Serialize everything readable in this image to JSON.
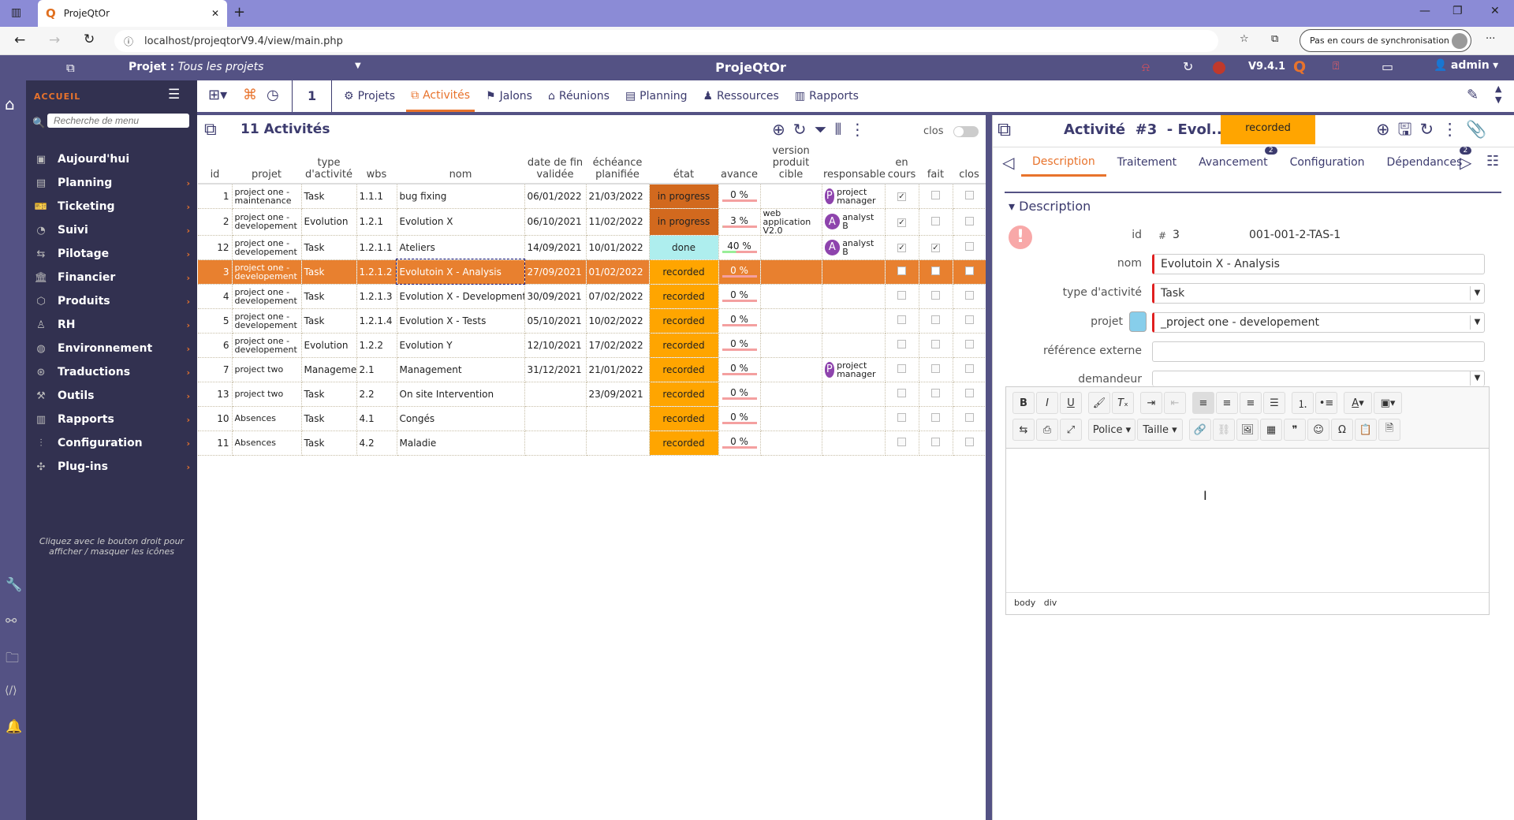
{
  "browser": {
    "tab_title": "ProjeQtOr",
    "url": "localhost/projeqtorV9.4/view/main.php",
    "sync_label": "Pas en cours de synchronisation"
  },
  "header": {
    "project_label": "Projet :",
    "project_value": "Tous les projets",
    "app_title": "ProjeQtOr",
    "version": "V9.4.1",
    "user": "admin"
  },
  "sidebar": {
    "title": "ACCUEIL",
    "search_placeholder": "Recherche de menu",
    "footer": "Cliquez avec le bouton droit pour afficher / masquer les icônes",
    "items": [
      {
        "label": "Aujourd'hui",
        "icon": "calendar-icon",
        "sub": false
      },
      {
        "label": "Planning",
        "icon": "planning-icon",
        "sub": true
      },
      {
        "label": "Ticketing",
        "icon": "ticket-icon",
        "sub": true
      },
      {
        "label": "Suivi",
        "icon": "follow-icon",
        "sub": true
      },
      {
        "label": "Pilotage",
        "icon": "signpost-icon",
        "sub": true
      },
      {
        "label": "Financier",
        "icon": "bank-icon",
        "sub": true
      },
      {
        "label": "Produits",
        "icon": "box-icon",
        "sub": true
      },
      {
        "label": "RH",
        "icon": "person-icon",
        "sub": true
      },
      {
        "label": "Environnement",
        "icon": "globe-icon",
        "sub": true
      },
      {
        "label": "Traductions",
        "icon": "translate-icon",
        "sub": true
      },
      {
        "label": "Outils",
        "icon": "hammer-icon",
        "sub": true
      },
      {
        "label": "Rapports",
        "icon": "chart-icon",
        "sub": true
      },
      {
        "label": "Configuration",
        "icon": "sliders-icon",
        "sub": true
      },
      {
        "label": "Plug-ins",
        "icon": "puzzle-icon",
        "sub": true
      }
    ]
  },
  "toolbar": {
    "count": "1",
    "tabs": [
      {
        "label": "Projets",
        "icon": "gear-icon"
      },
      {
        "label": "Activités",
        "icon": "activity-icon",
        "active": true
      },
      {
        "label": "Jalons",
        "icon": "flag-icon"
      },
      {
        "label": "Réunions",
        "icon": "meeting-icon"
      },
      {
        "label": "Planning",
        "icon": "planning-icon"
      },
      {
        "label": "Ressources",
        "icon": "resource-icon"
      },
      {
        "label": "Rapports",
        "icon": "chart-icon"
      }
    ]
  },
  "list": {
    "title": "11 Activités",
    "closed_label": "clos",
    "columns": [
      "id",
      "projet",
      "type d'activité",
      "wbs",
      "nom",
      "date de fin validée",
      "échéance planifiée",
      "état",
      "avance",
      "version produit cible",
      "responsable",
      "en cours",
      "fait",
      "clos"
    ],
    "rows": [
      {
        "id": "1",
        "projet": "project one - maintenance",
        "type": "Task",
        "wbs": "1.1.1",
        "nom": "bug fixing",
        "fin": "06/01/2022",
        "ech": "21/03/2022",
        "etat": "in progress",
        "avance": "0 %",
        "version": "",
        "resp": "project manager",
        "resp_initial": "P",
        "en_cours": true,
        "fait": false,
        "clos": false
      },
      {
        "id": "2",
        "projet": "project one - developement",
        "type": "Evolution",
        "wbs": "1.2.1",
        "nom": "Evolution X",
        "fin": "06/10/2021",
        "ech": "11/02/2022",
        "etat": "in progress",
        "avance": "3 %",
        "version": "web application V2.0",
        "resp": "analyst B",
        "resp_initial": "A",
        "en_cours": true,
        "fait": false,
        "clos": false
      },
      {
        "id": "12",
        "projet": "project one - developement",
        "type": "Task",
        "wbs": "1.2.1.1",
        "nom": "Ateliers",
        "fin": "14/09/2021",
        "ech": "10/01/2022",
        "etat": "done",
        "avance": "40 %",
        "version": "",
        "resp": "analyst B",
        "resp_initial": "A",
        "en_cours": true,
        "fait": true,
        "clos": false
      },
      {
        "id": "3",
        "projet": "project one - developement",
        "type": "Task",
        "wbs": "1.2.1.2",
        "nom": "Evolutoin X - Analysis",
        "fin": "27/09/2021",
        "ech": "01/02/2022",
        "etat": "recorded",
        "avance": "0 %",
        "version": "",
        "resp": "",
        "resp_initial": "",
        "en_cours": false,
        "fait": false,
        "clos": false,
        "selected": true
      },
      {
        "id": "4",
        "projet": "project one - developement",
        "type": "Task",
        "wbs": "1.2.1.3",
        "nom": "Evolution X - Development",
        "fin": "30/09/2021",
        "ech": "07/02/2022",
        "etat": "recorded",
        "avance": "0 %",
        "version": "",
        "resp": "",
        "resp_initial": "",
        "en_cours": false,
        "fait": false,
        "clos": false
      },
      {
        "id": "5",
        "projet": "project one - developement",
        "type": "Task",
        "wbs": "1.2.1.4",
        "nom": "Evolution X - Tests",
        "fin": "05/10/2021",
        "ech": "10/02/2022",
        "etat": "recorded",
        "avance": "0 %",
        "version": "",
        "resp": "",
        "resp_initial": "",
        "en_cours": false,
        "fait": false,
        "clos": false
      },
      {
        "id": "6",
        "projet": "project one - developement",
        "type": "Evolution",
        "wbs": "1.2.2",
        "nom": "Evolution Y",
        "fin": "12/10/2021",
        "ech": "17/02/2022",
        "etat": "recorded",
        "avance": "0 %",
        "version": "",
        "resp": "",
        "resp_initial": "",
        "en_cours": false,
        "fait": false,
        "clos": false
      },
      {
        "id": "7",
        "projet": "project two",
        "type": "Management",
        "wbs": "2.1",
        "nom": "Management",
        "fin": "31/12/2021",
        "ech": "21/01/2022",
        "etat": "recorded",
        "avance": "0 %",
        "version": "",
        "resp": "project manager",
        "resp_initial": "P",
        "en_cours": false,
        "fait": false,
        "clos": false
      },
      {
        "id": "13",
        "projet": "project two",
        "type": "Task",
        "wbs": "2.2",
        "nom": "On site Intervention",
        "fin": "",
        "ech": "23/09/2021",
        "etat": "recorded",
        "avance": "0 %",
        "version": "",
        "resp": "",
        "resp_initial": "",
        "en_cours": false,
        "fait": false,
        "clos": false
      },
      {
        "id": "10",
        "projet": "Absences",
        "type": "Task",
        "wbs": "4.1",
        "nom": "Congés",
        "fin": "",
        "ech": "",
        "etat": "recorded",
        "avance": "0 %",
        "version": "",
        "resp": "",
        "resp_initial": "",
        "en_cours": false,
        "fait": false,
        "clos": false
      },
      {
        "id": "11",
        "projet": "Absences",
        "type": "Task",
        "wbs": "4.2",
        "nom": "Maladie",
        "fin": "",
        "ech": "",
        "etat": "recorded",
        "avance": "0 %",
        "version": "",
        "resp": "",
        "resp_initial": "",
        "en_cours": false,
        "fait": false,
        "clos": false
      }
    ]
  },
  "state_colors": {
    "in progress": "#d2691e",
    "done": "#aeeeee",
    "recorded": "#ffa500"
  },
  "detail": {
    "title": "Activité  #3  - Evol...",
    "status": "recorded",
    "tabs": [
      {
        "label": "Description",
        "active": true
      },
      {
        "label": "Traitement"
      },
      {
        "label": "Avancement",
        "badge": "2"
      },
      {
        "label": "Configuration"
      },
      {
        "label": "Dépendances",
        "badge": "2"
      }
    ],
    "section": "Description",
    "fields": {
      "id_label": "id",
      "id_hash": "#",
      "id_value": "3",
      "reference": "001-001-2-TAS-1",
      "nom_label": "nom",
      "nom_value": "Evolutoin X - Analysis",
      "type_label": "type d'activité",
      "type_value": "Task",
      "projet_label": "projet",
      "projet_value": "_project one - developement",
      "projet_color": "#87ceeb",
      "ref_label": "référence externe",
      "ref_value": "",
      "demandeur_label": "demandeur",
      "demandeur_value": ""
    },
    "editor": {
      "font_label": "Police",
      "size_label": "Taille",
      "path": [
        "body",
        "div"
      ]
    }
  }
}
